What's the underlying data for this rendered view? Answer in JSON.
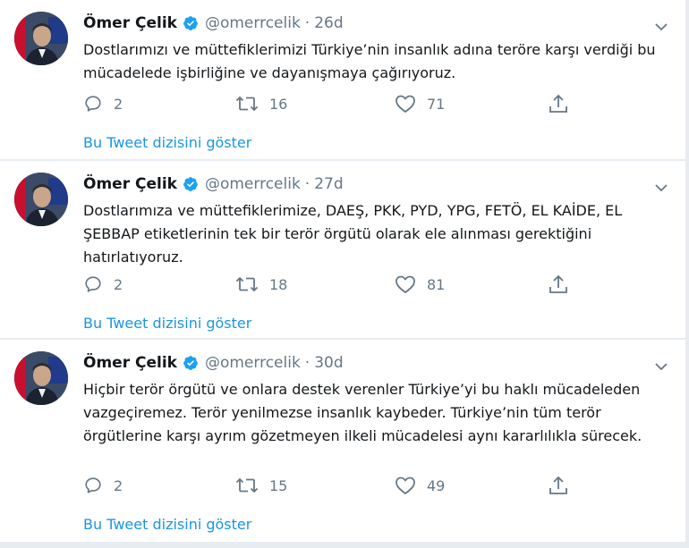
{
  "tweets": [
    {
      "name": "Ömer Çelik",
      "handle": "@omerrcelik",
      "separator": "·",
      "time": "26d",
      "text": "Dostlarımızı ve müttefiklerimizi Türkiye’nin insanlık adına teröre karşı verdiği bu mücadelede işbirliğine ve dayanışmaya çağırıyoruz.",
      "replies": "2",
      "retweets": "16",
      "likes": "71",
      "thread_link": "Bu Tweet dizisini göster"
    },
    {
      "name": "Ömer Çelik",
      "handle": "@omerrcelik",
      "separator": "·",
      "time": "27d",
      "text": "Dostlarımıza ve müttefiklerimize, DAEŞ, PKK, PYD, YPG, FETÖ, EL KAİDE, EL ŞEBBAP etiketlerinin tek bir terör örgütü olarak ele alınması gerektiğini hatırlatıyoruz.",
      "replies": "2",
      "retweets": "18",
      "likes": "81",
      "thread_link": "Bu Tweet dizisini göster"
    },
    {
      "name": "Ömer Çelik",
      "handle": "@omerrcelik",
      "separator": "·",
      "time": "30d",
      "text": "Hiçbir terör örgütü ve onlara destek verenler Türkiye’yi bu haklı mücadeleden vazgeçiremez. Terör yenilmezse insanlık kaybeder. Türkiye’nin tüm terör örgütlerine karşı ayrım gözetmeyen ilkeli mücadelesi aynı kararlılıkla sürecek.",
      "replies": "2",
      "retweets": "15",
      "likes": "49",
      "thread_link": "Bu Tweet dizisini göster"
    }
  ],
  "icons": {
    "verified": "verified-badge-icon",
    "caret": "chevron-down-icon",
    "reply": "reply-icon",
    "retweet": "retweet-icon",
    "like": "heart-icon",
    "share": "share-icon"
  },
  "colors": {
    "link": "#1b95e0",
    "muted": "#657786",
    "text": "#14171a",
    "verified": "#1da1f2",
    "divider": "#e6ecf0"
  }
}
